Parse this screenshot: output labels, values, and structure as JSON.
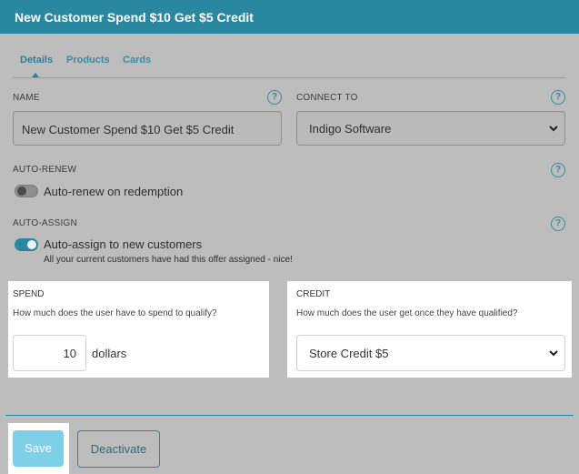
{
  "header": {
    "title": "New Customer Spend $10 Get $5 Credit"
  },
  "tabs": [
    {
      "label": "Details",
      "active": true
    },
    {
      "label": "Products",
      "active": false
    },
    {
      "label": "Cards",
      "active": false
    }
  ],
  "help_symbol": "?",
  "name_field": {
    "label": "NAME",
    "value": "New Customer Spend $10 Get $5 Credit"
  },
  "connect_to": {
    "label": "CONNECT TO",
    "selected": "Indigo Software"
  },
  "auto_renew": {
    "label": "AUTO-RENEW",
    "toggle_label": "Auto-renew on redemption",
    "enabled": false
  },
  "auto_assign": {
    "label": "AUTO-ASSIGN",
    "toggle_label": "Auto-assign to new customers",
    "note": "All your current customers have had this offer assigned - nice!",
    "enabled": true
  },
  "spend": {
    "label": "SPEND",
    "description": "How much does the user have to spend to qualify?",
    "value": "10",
    "unit": "dollars"
  },
  "credit": {
    "label": "CREDIT",
    "description": "How much does the user get once they have qualified?",
    "selected": "Store Credit $5"
  },
  "actions": {
    "save_label": "Save",
    "deactivate_label": "Deactivate"
  },
  "colors": {
    "accent": "#2a87a0",
    "save_button": "#7dd0e8",
    "overlay": "#bdbdbd"
  },
  "icons": {
    "help": "help-circle-icon",
    "dropdown": "chevron-down-icon"
  }
}
